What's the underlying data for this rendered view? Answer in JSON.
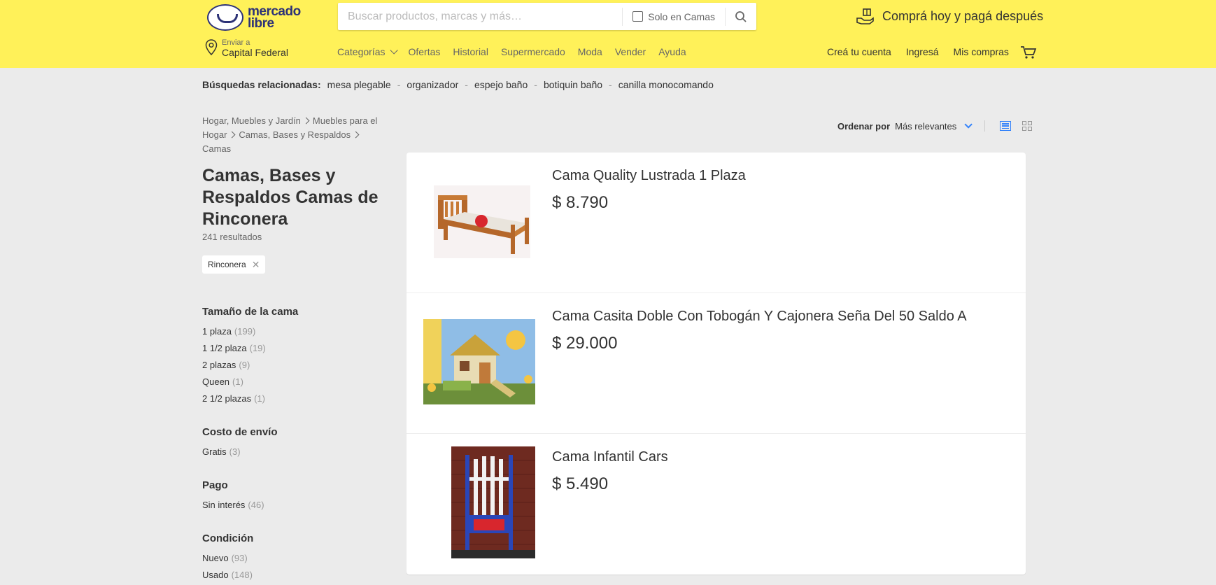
{
  "header": {
    "logo_line1": "mercado",
    "logo_line2": "libre",
    "search_placeholder": "Buscar productos, marcas y más…",
    "only_category": "Solo en Camas",
    "promo": "Comprá hoy y pagá después",
    "ship_small": "Enviar a",
    "ship_big": "Capital Federal",
    "nav": [
      "Categorías",
      "Ofertas",
      "Historial",
      "Supermercado",
      "Moda",
      "Vender",
      "Ayuda"
    ],
    "user_nav": [
      "Creá tu cuenta",
      "Ingresá",
      "Mis compras"
    ],
    "accent": "#fff159"
  },
  "related": {
    "label": "Búsquedas relacionadas:",
    "items": [
      "mesa plegable",
      "organizador",
      "espejo baño",
      "botiquin baño",
      "canilla monocomando"
    ]
  },
  "breadcrumb": [
    "Hogar, Muebles y Jardín",
    "Muebles para el Hogar",
    "Camas, Bases y Respaldos",
    "Camas"
  ],
  "page_title": "Camas, Bases y Respaldos Camas de Rinconera",
  "results_count": "241 resultados",
  "chip": "Rinconera",
  "filters": [
    {
      "title": "Tamaño de la cama",
      "items": [
        {
          "label": "1 plaza",
          "count": "(199)"
        },
        {
          "label": "1 1/2 plaza",
          "count": "(19)"
        },
        {
          "label": "2 plazas",
          "count": "(9)"
        },
        {
          "label": "Queen",
          "count": "(1)"
        },
        {
          "label": "2 1/2 plazas",
          "count": "(1)"
        }
      ]
    },
    {
      "title": "Costo de envío",
      "items": [
        {
          "label": "Gratis",
          "count": "(3)"
        }
      ]
    },
    {
      "title": "Pago",
      "items": [
        {
          "label": "Sin interés",
          "count": "(46)"
        }
      ]
    },
    {
      "title": "Condición",
      "items": [
        {
          "label": "Nuevo",
          "count": "(93)"
        },
        {
          "label": "Usado",
          "count": "(148)"
        }
      ]
    }
  ],
  "sort": {
    "label": "Ordenar por",
    "value": "Más relevantes"
  },
  "products": [
    {
      "title": "Cama Quality Lustrada 1 Plaza",
      "price": "$ 8.790"
    },
    {
      "title": "Cama Casita Doble Con Tobogán Y Cajonera Seña Del 50 Saldo A",
      "price": "$ 29.000"
    },
    {
      "title": "Cama Infantil Cars",
      "price": "$ 5.490"
    }
  ]
}
